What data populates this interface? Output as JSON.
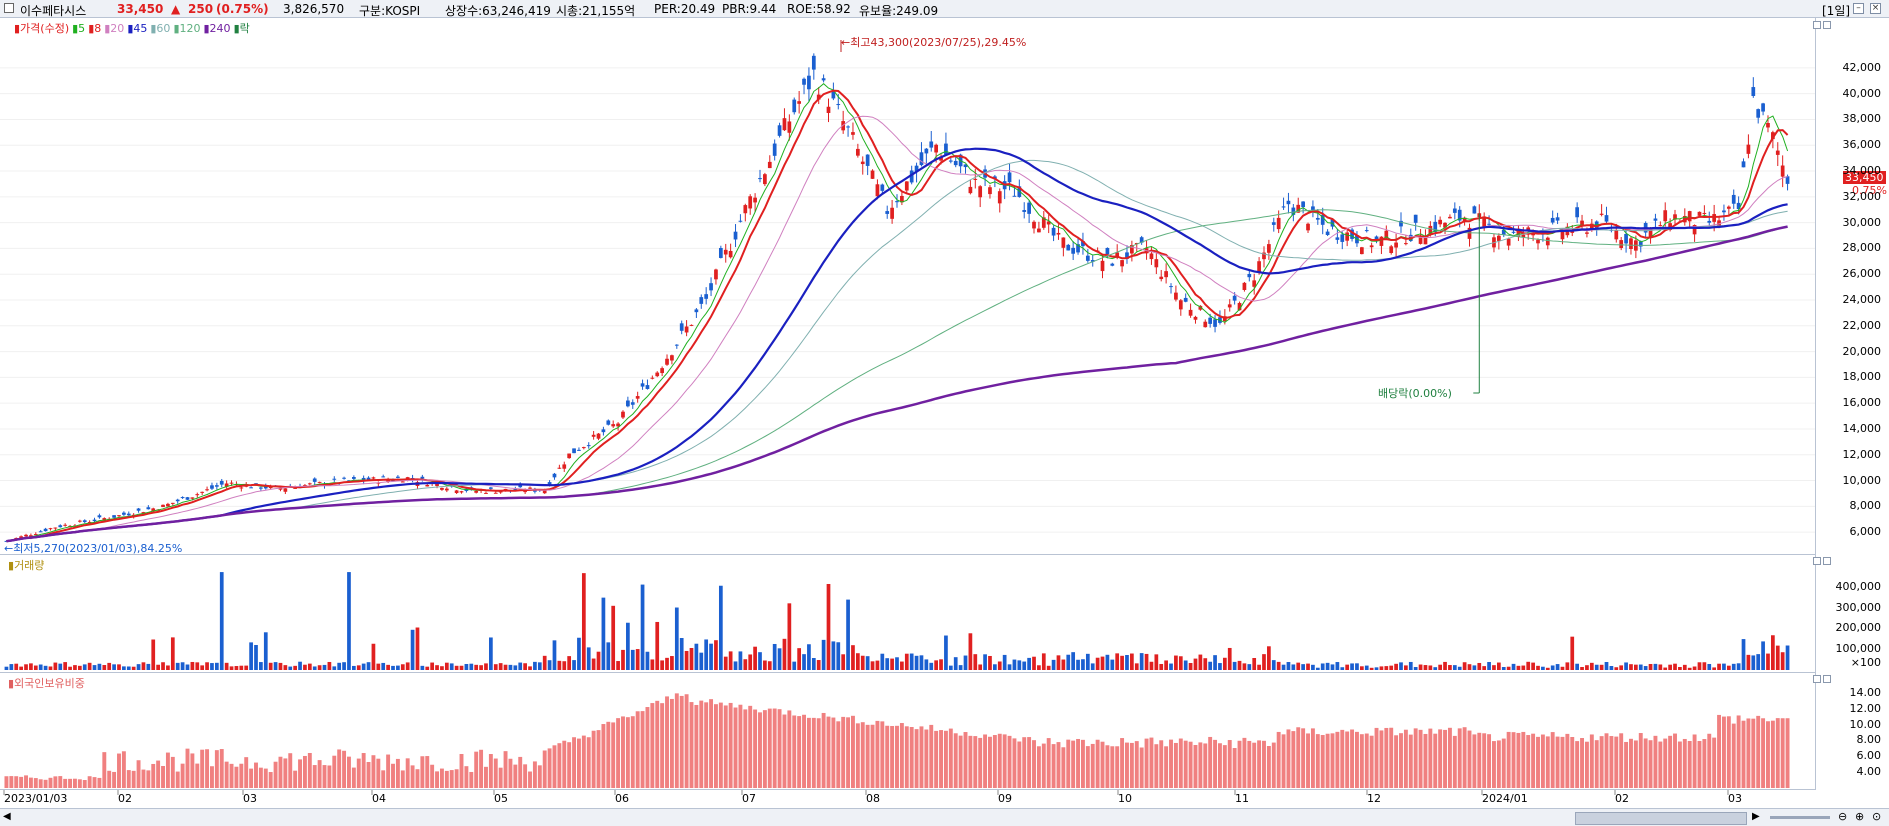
{
  "header": {
    "name": "이수페타시스",
    "price": "33,450",
    "change_arrow": "▲",
    "change": "250",
    "change_pct": "(0.75%)",
    "volume": "3,826,570",
    "market": "구분:KOSPI",
    "shares": "상장수:63,246,419",
    "cap": "시총:21,155억",
    "per": "PER:20.49",
    "pbr": "PBR:9.44",
    "roe": "ROE:58.92",
    "float": "유보율:249.09",
    "period": "[1일]",
    "up_color": "#e02020",
    "down_color": "#1a5fd0"
  },
  "price_panel": {
    "legend": [
      {
        "label": "가격(수정)",
        "color": "#e02020"
      },
      {
        "label": "5",
        "color": "#20b020"
      },
      {
        "label": "8",
        "color": "#e02020"
      },
      {
        "label": "20",
        "color": "#d080c0"
      },
      {
        "label": "45",
        "color": "#1a20c0"
      },
      {
        "label": "60",
        "color": "#80b0b0"
      },
      {
        "label": "120",
        "color": "#60b080"
      },
      {
        "label": "240",
        "color": "#7020a0"
      },
      {
        "label": "락",
        "color": "#208040"
      }
    ],
    "high_note": "최고43,300(2023/07/25),29.45%",
    "low_note": "최저5,270(2023/01/03),84.25%",
    "dividend_note": "배당락(0.00%)",
    "current_tag": "33,450",
    "pct_tag": "0.75%",
    "y_labels": [
      "42,000",
      "40,000",
      "38,000",
      "36,000",
      "34,000",
      "32,000",
      "30,000",
      "28,000",
      "26,000",
      "24,000",
      "22,000",
      "20,000",
      "18,000",
      "16,000",
      "14,000",
      "12,000",
      "10,000",
      "8,000",
      "6,000"
    ]
  },
  "volume_panel": {
    "title": "거래량",
    "y_labels": [
      "400,000",
      "300,000",
      "200,000",
      "100,000"
    ],
    "unit": "×100"
  },
  "foreign_panel": {
    "title": "외국인보유비중",
    "y_labels": [
      "14.00",
      "12.00",
      "10.00",
      "8.00",
      "6.00",
      "4.00"
    ]
  },
  "x_axis": {
    "labels": [
      "2023/01/03",
      "02",
      "03",
      "04",
      "05",
      "06",
      "07",
      "08",
      "09",
      "10",
      "11",
      "12",
      "2024/01",
      "02",
      "03"
    ]
  },
  "chart_data": {
    "type": "candlestick",
    "period": "daily",
    "y_range": [
      5000,
      44000
    ],
    "high": {
      "value": 43300,
      "date": "2023/07/25"
    },
    "low": {
      "value": 5270,
      "date": "2023/01/03"
    },
    "current": 33450,
    "monthly_close_approx": [
      {
        "month": "2023/01",
        "close": 7000
      },
      {
        "month": "2023/02",
        "close": 8500
      },
      {
        "month": "2023/03",
        "close": 9500
      },
      {
        "month": "2023/04",
        "close": 9200
      },
      {
        "month": "2023/05",
        "close": 12500
      },
      {
        "month": "2023/06",
        "close": 24000
      },
      {
        "month": "2023/07",
        "close": 39000
      },
      {
        "month": "2023/08",
        "close": 33000
      },
      {
        "month": "2023/09",
        "close": 28000
      },
      {
        "month": "2023/10",
        "close": 23000
      },
      {
        "month": "2023/11",
        "close": 30500
      },
      {
        "month": "2023/12",
        "close": 29500
      },
      {
        "month": "2024/01",
        "close": 28800
      },
      {
        "month": "2024/02",
        "close": 30000
      },
      {
        "month": "2024/03",
        "close": 33450
      }
    ],
    "volume_unit": "×100",
    "volume_range": [
      0,
      480000
    ],
    "foreign_ratio_range": [
      2,
      15
    ]
  }
}
